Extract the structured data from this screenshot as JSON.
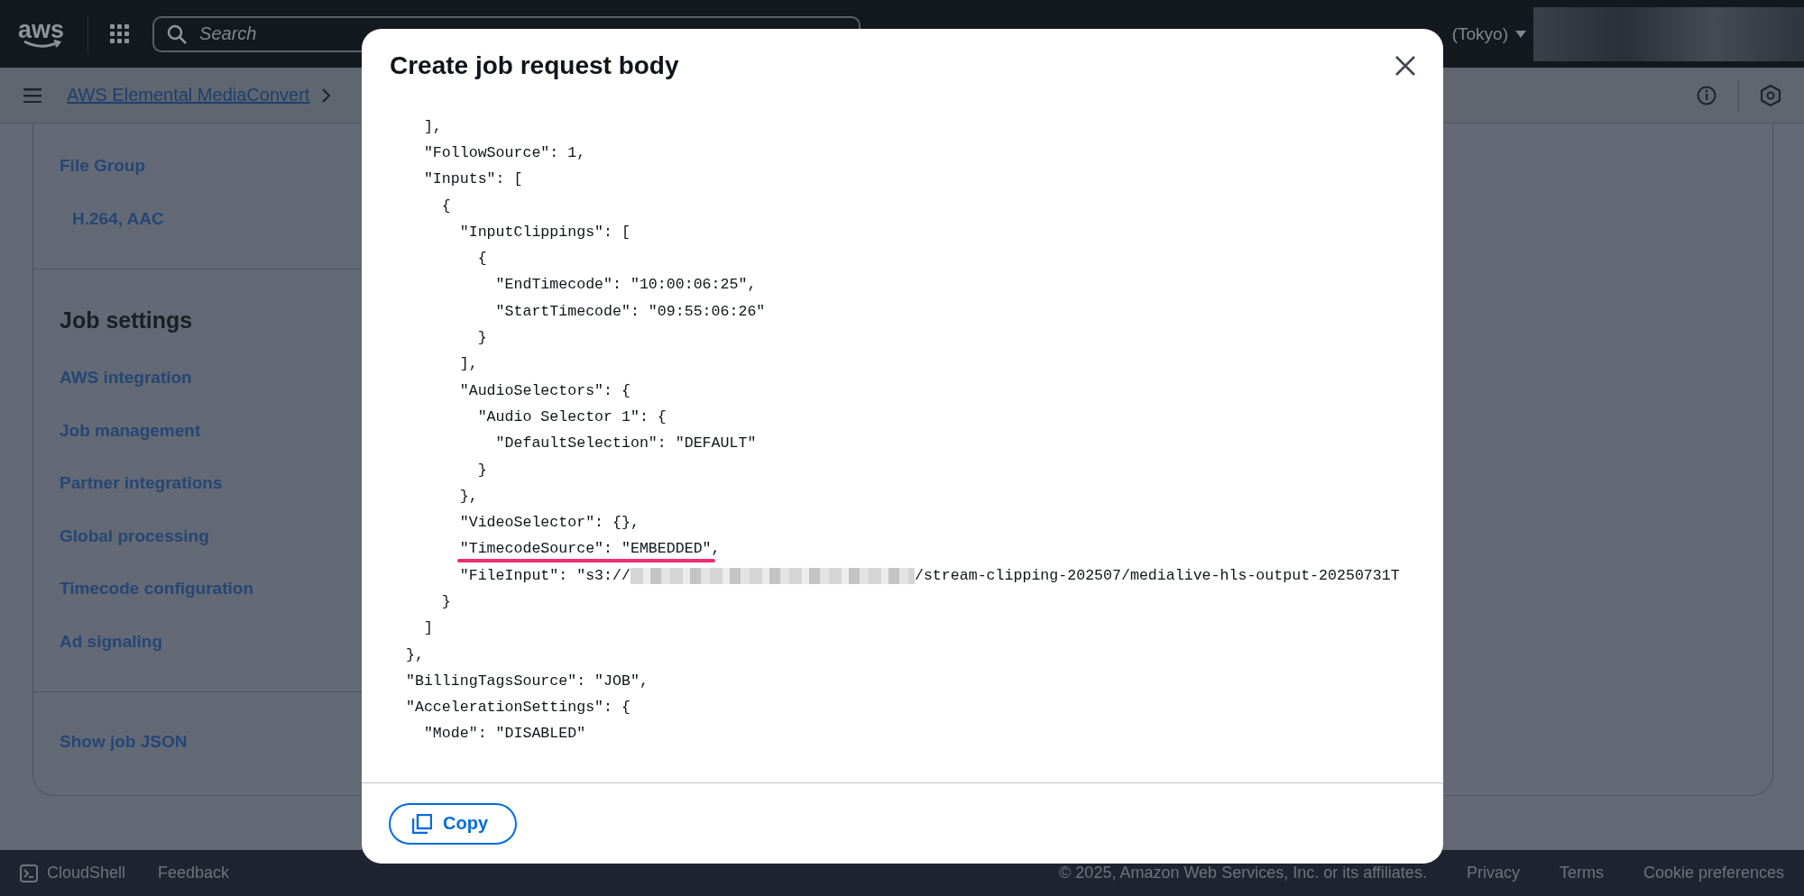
{
  "top_bar": {
    "logo": "aws",
    "search": {
      "placeholder": "Search"
    },
    "region": "(Tokyo)"
  },
  "breadcrumb": {
    "items": [
      "AWS Elemental MediaConvert"
    ]
  },
  "sidebar": {
    "sections": [
      {
        "items": [
          {
            "label": "File Group",
            "kind": "link"
          },
          {
            "label": "H.264, AAC",
            "kind": "sublink"
          }
        ]
      },
      {
        "heading": "Job settings",
        "items": [
          {
            "label": "AWS integration",
            "kind": "link"
          },
          {
            "label": "Job management",
            "kind": "link"
          },
          {
            "label": "Partner integrations",
            "kind": "link"
          },
          {
            "label": "Global processing",
            "kind": "link"
          },
          {
            "label": "Timecode configuration",
            "kind": "link"
          },
          {
            "label": "Ad signaling",
            "kind": "link"
          }
        ]
      },
      {
        "items": [
          {
            "label": "Show job JSON",
            "kind": "link"
          }
        ]
      }
    ]
  },
  "modal": {
    "title": "Create job request body",
    "code_lines": [
      {
        "text": "  ],",
        "kind": "plain"
      },
      {
        "text": "  \"FollowSource\": 1,",
        "kind": "plain"
      },
      {
        "text": "  \"Inputs\": [",
        "kind": "plain"
      },
      {
        "text": "    {",
        "kind": "plain"
      },
      {
        "text": "      \"InputClippings\": [",
        "kind": "plain"
      },
      {
        "text": "        {",
        "kind": "plain"
      },
      {
        "text": "          \"EndTimecode\": \"10:00:06:25\",",
        "kind": "plain"
      },
      {
        "text": "          \"StartTimecode\": \"09:55:06:26\"",
        "kind": "plain"
      },
      {
        "text": "        }",
        "kind": "plain"
      },
      {
        "text": "      ],",
        "kind": "plain"
      },
      {
        "text": "      \"AudioSelectors\": {",
        "kind": "plain"
      },
      {
        "text": "        \"Audio Selector 1\": {",
        "kind": "plain"
      },
      {
        "text": "          \"DefaultSelection\": \"DEFAULT\"",
        "kind": "plain"
      },
      {
        "text": "        }",
        "kind": "plain"
      },
      {
        "text": "      },",
        "kind": "plain"
      },
      {
        "text": "      \"VideoSelector\": {},",
        "kind": "plain"
      },
      {
        "text": "      \"TimecodeSource\": \"EMBEDDED\",",
        "kind": "underlined"
      },
      {
        "text": "      \"FileInput\": \"s3://",
        "after": "/stream-clipping-202507/medialive-hls-output-20250731T",
        "kind": "redacted"
      },
      {
        "text": "    }",
        "kind": "plain"
      },
      {
        "text": "  ]",
        "kind": "plain"
      },
      {
        "text": "},",
        "kind": "plain"
      },
      {
        "text": "\"BillingTagsSource\": \"JOB\",",
        "kind": "plain"
      },
      {
        "text": "\"AccelerationSettings\": {",
        "kind": "plain"
      },
      {
        "text": "  \"Mode\": \"DISABLED\"",
        "kind": "plain"
      }
    ],
    "copy_button": "Copy"
  },
  "footer": {
    "left": [
      "CloudShell",
      "Feedback"
    ],
    "copyright": "© 2025, Amazon Web Services, Inc. or its affiliates.",
    "links": [
      "Privacy",
      "Terms",
      "Cookie preferences"
    ]
  }
}
